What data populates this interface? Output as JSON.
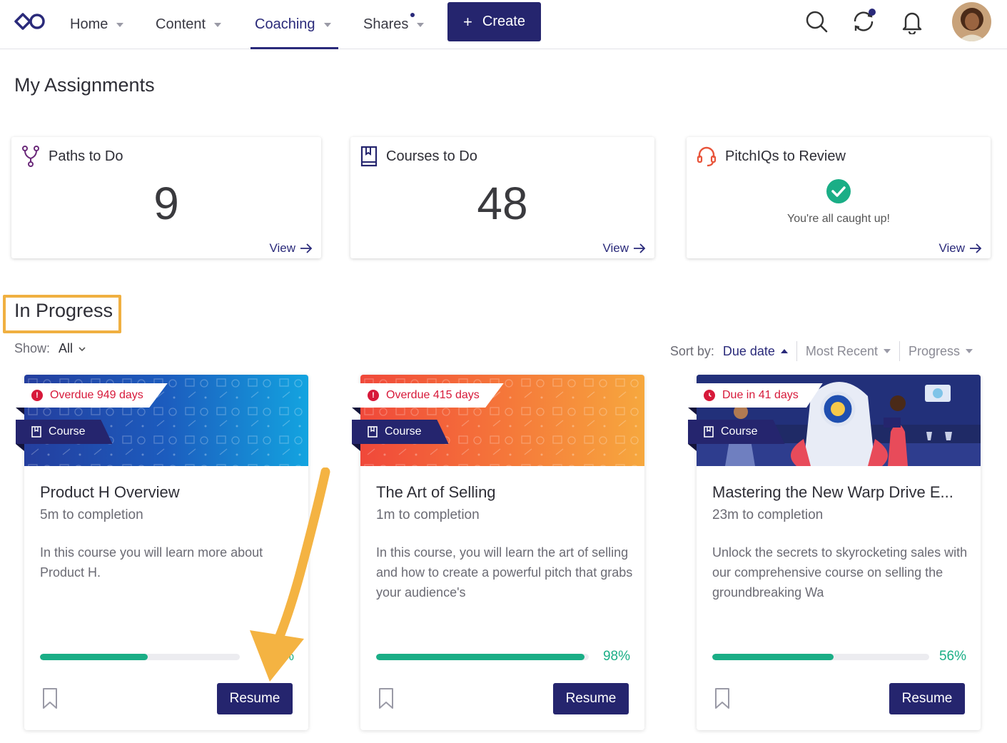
{
  "nav": {
    "items": [
      {
        "label": "Home"
      },
      {
        "label": "Content"
      },
      {
        "label": "Coaching"
      },
      {
        "label": "Shares"
      }
    ],
    "create_label": "Create",
    "active": "Coaching"
  },
  "page_title": "My Assignments",
  "stats": [
    {
      "label": "Paths to Do",
      "value": "9",
      "view": "View"
    },
    {
      "label": "Courses to Do",
      "value": "48",
      "view": "View"
    },
    {
      "label": "PitchIQs to Review",
      "message": "You're all caught up!",
      "view": "View"
    }
  ],
  "section_title": "In Progress",
  "filter": {
    "show_label": "Show:",
    "show_value": "All"
  },
  "sort": {
    "label": "Sort by:",
    "options": [
      "Due date",
      "Most Recent",
      "Progress"
    ],
    "selected": "Due date"
  },
  "courses": [
    {
      "status": "Overdue 949 days",
      "type": "Course",
      "title": "Product H Overview",
      "time": "5m to completion",
      "description": "In this course you will learn more about Product H.",
      "progress": 0.54,
      "progress_label": "54%",
      "resume": "Resume"
    },
    {
      "status": "Overdue 415 days",
      "type": "Course",
      "title": "The Art of Selling",
      "time": "1m to completion",
      "description": "In this course, you will learn the art of selling and how to create a powerful pitch that grabs your audience's",
      "progress": 0.98,
      "progress_label": "98%",
      "resume": "Resume"
    },
    {
      "status": "Due in 41 days",
      "type": "Course",
      "title": "Mastering the New Warp Drive E...",
      "time": "23m to completion",
      "description": "Unlock the secrets to skyrocketing sales with our comprehensive course on selling the groundbreaking Wa",
      "progress": 0.56,
      "progress_label": "56%",
      "resume": "Resume"
    }
  ],
  "colors": {
    "brand": "#25256e",
    "overdue": "#d7193a",
    "progress": "#1aae86",
    "highlight": "#f0b041"
  }
}
